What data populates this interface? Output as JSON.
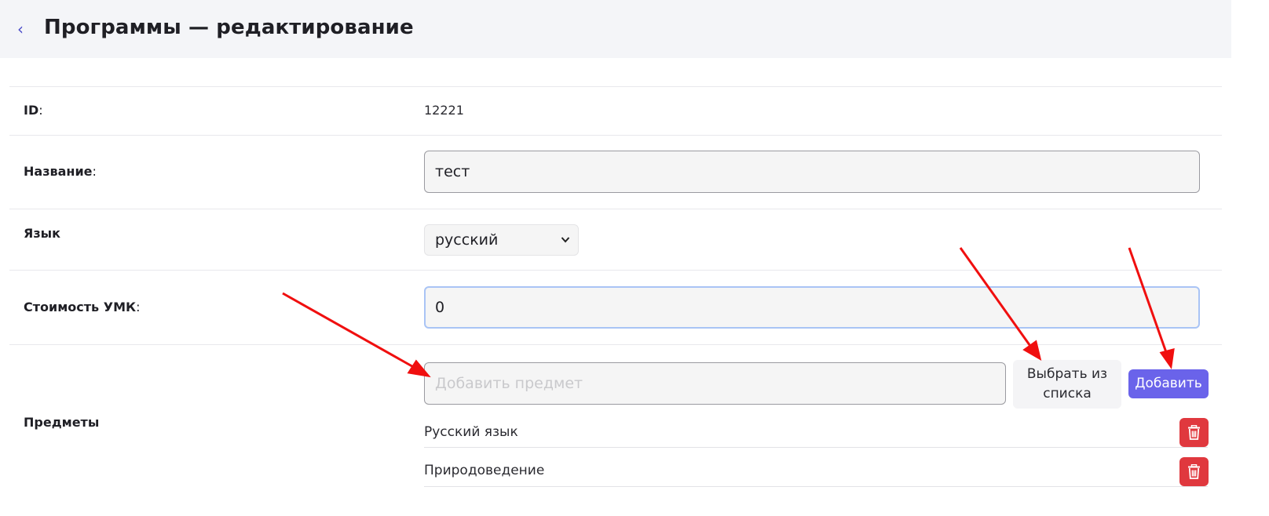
{
  "header": {
    "back_glyph": "‹",
    "title": "Программы — редактирование"
  },
  "form": {
    "id_label": "ID",
    "id_value": "12221",
    "name_label": "Название",
    "name_value": "тест",
    "lang_label": "Язык",
    "lang_value": "русский",
    "cost_label": "Стоимость УМК",
    "cost_value": "0",
    "subjects_label": "Предметы",
    "colon": ":"
  },
  "subjects": {
    "add_placeholder": "Добавить предмет",
    "choose_button_line1": "Выбрать из",
    "choose_button_line2": "списка",
    "add_button": "Добавить",
    "items": [
      {
        "label": "Русский язык"
      },
      {
        "label": "Природоведение"
      }
    ]
  },
  "icons": {
    "back": "chevron-left-icon",
    "select": "chevron-down-icon",
    "delete": "trash-icon"
  },
  "colors": {
    "accent": "#6a63ea",
    "danger": "#e0383e",
    "annotation_arrow": "#f00f0f",
    "focus_border": "#a9c4f5"
  }
}
